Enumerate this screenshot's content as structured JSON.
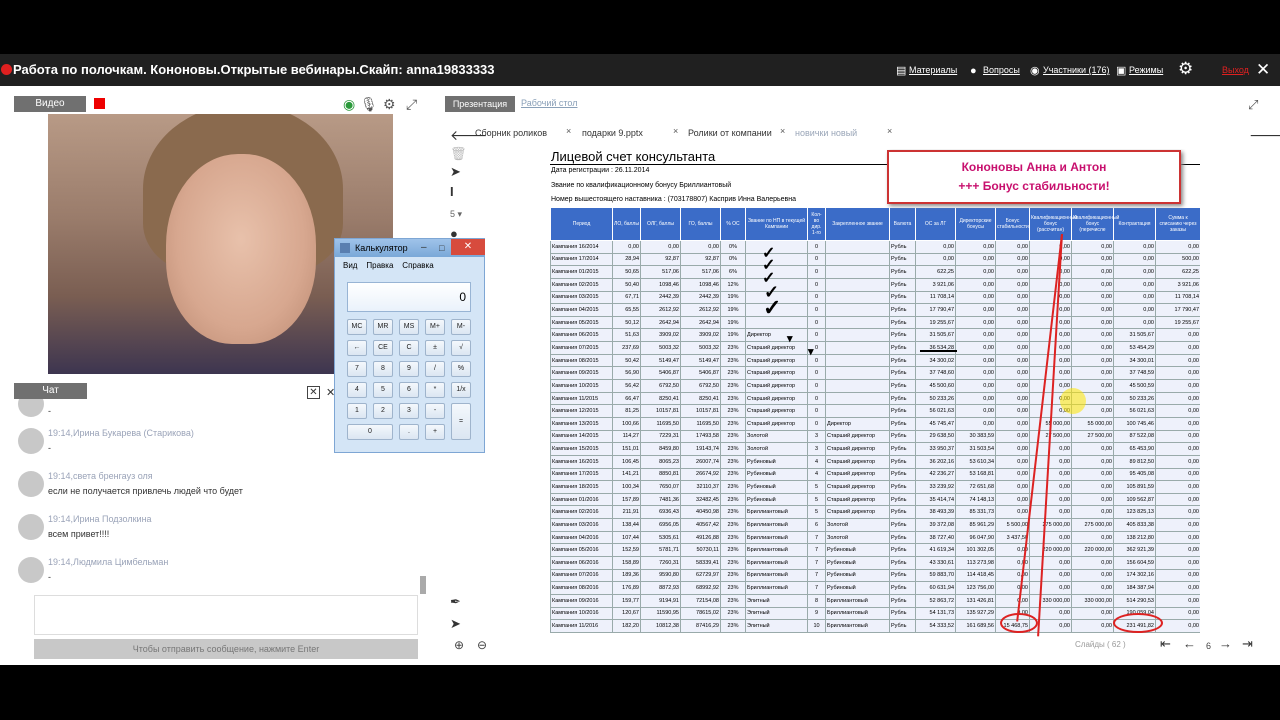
{
  "app": {
    "title": "Работа по полочкам. Кононовы.Открытые вебинары.Скайп: anna19833333",
    "toolbar": {
      "materials": "Материалы",
      "questions": "Вопросы",
      "participants": "Участники (176)",
      "modes": "Режимы",
      "exit": "Выход"
    },
    "icons": {
      "materials": "book-icon",
      "questions": "chat-bubble-icon",
      "participants": "eye-icon",
      "modes": "screen-icon",
      "settings": "gear-icon",
      "close": "close-icon"
    }
  },
  "video": {
    "label": "Видео"
  },
  "chat": {
    "label": "Чат",
    "messages": [
      {
        "time": "",
        "author": "",
        "text": "-"
      },
      {
        "time": "19:14,",
        "author": "Ирина Букарева (Старикова)",
        "text": "-"
      },
      {
        "time": "19:14,",
        "author": "света бренгауз оля",
        "text": "если не получается привлечь людей что будет"
      },
      {
        "time": "19:14,",
        "author": "Ирина Подзолкина",
        "text": "всем привет!!!!"
      },
      {
        "time": "19:14,",
        "author": "Людмила Цимбельман",
        "text": "-"
      }
    ],
    "send_hint": "Чтобы отправить сообщение, нажмите Enter"
  },
  "calculator": {
    "title": "Калькулятор",
    "menu": [
      "Вид",
      "Правка",
      "Справка"
    ],
    "display": "0",
    "keys": [
      [
        "MC",
        "MR",
        "MS",
        "M+",
        "M-"
      ],
      [
        "←",
        "CE",
        "C",
        "±",
        "√"
      ],
      [
        "7",
        "8",
        "9",
        "/",
        "%"
      ],
      [
        "4",
        "5",
        "6",
        "*",
        "1/x"
      ],
      [
        "1",
        "2",
        "3",
        "-",
        "="
      ],
      [
        "0",
        ".",
        "+"
      ]
    ]
  },
  "presentation": {
    "tab_presentation": "Презентация",
    "tab_desktop": "Рабочий стол",
    "file_tabs": [
      "Сборник роликов",
      "подарки 9.pptx",
      "Ролики от компании",
      "новички новый"
    ],
    "slides_label": "Слайды ( 62 )",
    "current_page": "6",
    "tool_size": "5"
  },
  "slide": {
    "title": "Лицевой счет консультанта",
    "reg_date": "Дата регистрации : 26.11.2014",
    "rank": "Звание по квалификационному бонусу Бриллиантовый",
    "mentor": "Номер вышестоящего наставника : (703178807) Касприв Инна Валерьевна",
    "banner_line1": "Кононовы Анна и Антон",
    "banner_line2": "+++ Бонус стабильности!",
    "columns": [
      "Период",
      "ЛО, баллы",
      "ОЛГ, баллы",
      "ГО, баллы",
      "% ОС",
      "Звание по НП в текущей Кампании",
      "Кол-во дир. 1-го",
      "Закрепленное звание",
      "Валюта",
      "ОС за ЛГ",
      "Директорские бонусы",
      "Бонус стабильности",
      "Квалификационный бонус (рассчитан)",
      "Квалификационный бонус (перечисле",
      "Контрактация",
      "Сумма к списанию через заказы"
    ],
    "rows": [
      [
        "Кампания 16/2014",
        "0,00",
        "0,00",
        "0,00",
        "0%",
        "",
        "0",
        "",
        "Рубль",
        "0,00",
        "0,00",
        "0,00",
        "0,00",
        "0,00",
        "0,00",
        "0,00"
      ],
      [
        "Кампания 17/2014",
        "28,94",
        "92,87",
        "92,87",
        "0%",
        "",
        "0",
        "",
        "Рубль",
        "0,00",
        "0,00",
        "0,00",
        "0,00",
        "0,00",
        "0,00",
        "500,00"
      ],
      [
        "Кампания 01/2015",
        "50,65",
        "517,06",
        "517,06",
        "6%",
        "",
        "0",
        "",
        "Рубль",
        "622,25",
        "0,00",
        "0,00",
        "0,00",
        "0,00",
        "0,00",
        "622,25"
      ],
      [
        "Кампания 02/2015",
        "50,40",
        "1098,46",
        "1098,46",
        "12%",
        "",
        "0",
        "",
        "Рубль",
        "3 921,06",
        "0,00",
        "0,00",
        "0,00",
        "0,00",
        "0,00",
        "3 921,06"
      ],
      [
        "Кампания 03/2015",
        "67,71",
        "2442,39",
        "2442,39",
        "19%",
        "",
        "0",
        "",
        "Рубль",
        "11 708,14",
        "0,00",
        "0,00",
        "0,00",
        "0,00",
        "0,00",
        "11 708,14"
      ],
      [
        "Кампания 04/2015",
        "65,55",
        "2612,92",
        "2612,92",
        "19%",
        "",
        "0",
        "",
        "Рубль",
        "17 790,47",
        "0,00",
        "0,00",
        "0,00",
        "0,00",
        "0,00",
        "17 790,47"
      ],
      [
        "Кампания 05/2015",
        "50,12",
        "2642,94",
        "2642,94",
        "19%",
        "",
        "0",
        "",
        "Рубль",
        "19 255,67",
        "0,00",
        "0,00",
        "0,00",
        "0,00",
        "0,00",
        "19 255,67"
      ],
      [
        "Кампания 06/2015",
        "51,63",
        "3909,02",
        "3909,02",
        "19%",
        "Директор",
        "0",
        "",
        "Рубль",
        "31 505,67",
        "0,00",
        "0,00",
        "0,00",
        "0,00",
        "31 505,67",
        "0,00"
      ],
      [
        "Кампания 07/2015",
        "237,69",
        "5003,32",
        "5003,32",
        "23%",
        "Старший директор",
        "0",
        "",
        "Рубль",
        "36 534,28",
        "0,00",
        "0,00",
        "0,00",
        "0,00",
        "53 454,29",
        "0,00"
      ],
      [
        "Кампания 08/2015",
        "50,42",
        "5149,47",
        "5149,47",
        "23%",
        "Старший директор",
        "0",
        "",
        "Рубль",
        "34 300,02",
        "0,00",
        "0,00",
        "0,00",
        "0,00",
        "34 300,01",
        "0,00"
      ],
      [
        "Кампания 09/2015",
        "56,90",
        "5406,87",
        "5406,87",
        "23%",
        "Старший директор",
        "0",
        "",
        "Рубль",
        "37 748,60",
        "0,00",
        "0,00",
        "0,00",
        "0,00",
        "37 748,59",
        "0,00"
      ],
      [
        "Кампания 10/2015",
        "56,42",
        "6792,50",
        "6792,50",
        "23%",
        "Старший директор",
        "0",
        "",
        "Рубль",
        "45 500,60",
        "0,00",
        "0,00",
        "0,00",
        "0,00",
        "45 500,59",
        "0,00"
      ],
      [
        "Кампания 11/2015",
        "66,47",
        "8250,41",
        "8250,41",
        "23%",
        "Старший директор",
        "0",
        "",
        "Рубль",
        "50 233,26",
        "0,00",
        "0,00",
        "0,00",
        "0,00",
        "50 233,26",
        "0,00"
      ],
      [
        "Кампания 12/2015",
        "81,25",
        "10157,81",
        "10157,81",
        "23%",
        "Старший директор",
        "0",
        "",
        "Рубль",
        "56 021,63",
        "0,00",
        "0,00",
        "0,00",
        "0,00",
        "56 021,63",
        "0,00"
      ],
      [
        "Кампания 13/2015",
        "100,66",
        "11695,50",
        "11695,50",
        "23%",
        "Старший директор",
        "0",
        "Директор",
        "Рубль",
        "45 745,47",
        "0,00",
        "0,00",
        "55 000,00",
        "55 000,00",
        "100 745,46",
        "0,00"
      ],
      [
        "Кампания 14/2015",
        "114,27",
        "7229,31",
        "17493,58",
        "23%",
        "Золотой",
        "3",
        "Старший директор",
        "Рубль",
        "29 638,50",
        "30 383,59",
        "0,00",
        "27 500,00",
        "27 500,00",
        "87 522,08",
        "0,00"
      ],
      [
        "Кампания 15/2015",
        "151,01",
        "8459,80",
        "19143,74",
        "23%",
        "Золотой",
        "3",
        "Старший директор",
        "Рубль",
        "33 950,37",
        "31 503,54",
        "0,00",
        "0,00",
        "0,00",
        "65 453,90",
        "0,00"
      ],
      [
        "Кампания 16/2015",
        "106,45",
        "8065,23",
        "26007,74",
        "23%",
        "Рубиновый",
        "4",
        "Старший директор",
        "Рубль",
        "36 202,16",
        "53 610,34",
        "0,00",
        "0,00",
        "0,00",
        "89 812,50",
        "0,00"
      ],
      [
        "Кампания 17/2015",
        "141,21",
        "8850,81",
        "26674,92",
        "23%",
        "Рубиновый",
        "4",
        "Старший директор",
        "Рубль",
        "42 236,27",
        "53 168,81",
        "0,00",
        "0,00",
        "0,00",
        "95 405,08",
        "0,00"
      ],
      [
        "Кампания 18/2015",
        "100,34",
        "7650,07",
        "32110,37",
        "23%",
        "Рубиновый",
        "5",
        "Старший директор",
        "Рубль",
        "33 239,92",
        "72 651,68",
        "0,00",
        "0,00",
        "0,00",
        "105 891,59",
        "0,00"
      ],
      [
        "Кампания 01/2016",
        "157,89",
        "7481,36",
        "32482,45",
        "23%",
        "Рубиновый",
        "5",
        "Старший директор",
        "Рубль",
        "35 414,74",
        "74 148,13",
        "0,00",
        "0,00",
        "0,00",
        "109 562,87",
        "0,00"
      ],
      [
        "Кампания 02/2016",
        "211,91",
        "6936,43",
        "40450,98",
        "23%",
        "Бриллиантовый",
        "5",
        "Старший директор",
        "Рубль",
        "38 493,39",
        "85 331,73",
        "0,00",
        "0,00",
        "0,00",
        "123 825,13",
        "0,00"
      ],
      [
        "Кампания 03/2016",
        "138,44",
        "6956,05",
        "40567,42",
        "23%",
        "Бриллиантовый",
        "6",
        "Золотой",
        "Рубль",
        "39 372,08",
        "85 961,29",
        "5 500,00",
        "275 000,00",
        "275 000,00",
        "405 833,38",
        "0,00"
      ],
      [
        "Кампания 04/2016",
        "107,44",
        "5305,61",
        "49126,88",
        "23%",
        "Бриллиантовый",
        "7",
        "Золотой",
        "Рубль",
        "38 727,40",
        "96 047,90",
        "3 437,50",
        "0,00",
        "0,00",
        "138 212,80",
        "0,00"
      ],
      [
        "Кампания 05/2016",
        "152,59",
        "5781,71",
        "50730,11",
        "23%",
        "Бриллиантовый",
        "7",
        "Рубиновый",
        "Рубль",
        "41 619,34",
        "101 302,05",
        "0,00",
        "220 000,00",
        "220 000,00",
        "362 921,39",
        "0,00"
      ],
      [
        "Кампания 06/2016",
        "158,89",
        "7260,31",
        "58339,41",
        "23%",
        "Бриллиантовый",
        "7",
        "Рубиновый",
        "Рубль",
        "43 330,61",
        "113 273,98",
        "0,00",
        "0,00",
        "0,00",
        "156 604,59",
        "0,00"
      ],
      [
        "Кампания 07/2016",
        "189,36",
        "9590,80",
        "62729,97",
        "23%",
        "Бриллиантовый",
        "7",
        "Рубиновый",
        "Рубль",
        "59 883,70",
        "114 418,45",
        "0,00",
        "0,00",
        "0,00",
        "174 302,16",
        "0,00"
      ],
      [
        "Кампания 08/2016",
        "176,89",
        "8872,93",
        "68992,92",
        "23%",
        "Бриллиантовый",
        "7",
        "Рубиновый",
        "Рубль",
        "60 631,94",
        "123 756,00",
        "0,00",
        "0,00",
        "0,00",
        "184 387,94",
        "0,00"
      ],
      [
        "Кампания 09/2016",
        "159,77",
        "9194,91",
        "72154,08",
        "23%",
        "Элитный",
        "8",
        "Бриллиантовый",
        "Рубль",
        "52 863,72",
        "131 426,81",
        "0,00",
        "330 000,00",
        "330 000,00",
        "514 290,53",
        "0,00"
      ],
      [
        "Кампания 10/2016",
        "120,67",
        "11590,95",
        "78615,02",
        "23%",
        "Элитный",
        "9",
        "Бриллиантовый",
        "Рубль",
        "54 131,73",
        "135 927,29",
        "0,00",
        "0,00",
        "0,00",
        "190 059,04",
        "0,00"
      ],
      [
        "Кампания 11/2016",
        "182,20",
        "10812,38",
        "87416,29",
        "23%",
        "Элитный",
        "10",
        "Бриллиантовый",
        "Рубль",
        "54 333,52",
        "161 689,56",
        "15 468,75",
        "0,00",
        "0,00",
        "231 491,82",
        "0,00"
      ]
    ]
  },
  "colors": {
    "accent_red": "#e02020",
    "table_header": "#3b6cc8",
    "banner_text": "#c8106e"
  }
}
